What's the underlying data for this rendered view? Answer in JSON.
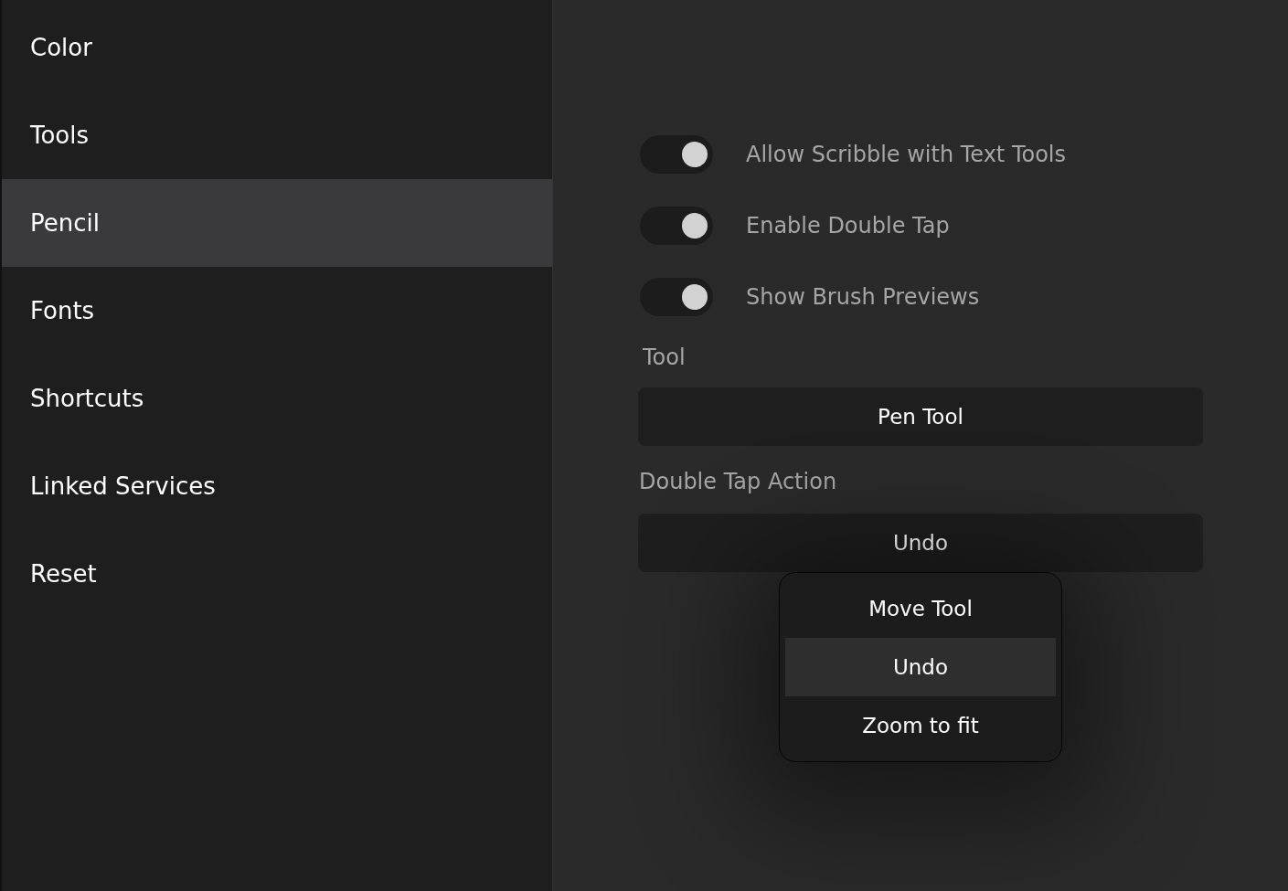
{
  "sidebar": {
    "items": [
      {
        "label": "Color",
        "selected": false
      },
      {
        "label": "Tools",
        "selected": false
      },
      {
        "label": "Pencil",
        "selected": true
      },
      {
        "label": "Fonts",
        "selected": false
      },
      {
        "label": "Shortcuts",
        "selected": false
      },
      {
        "label": "Linked Services",
        "selected": false
      },
      {
        "label": "Reset",
        "selected": false
      }
    ]
  },
  "toggles": [
    {
      "label": "Allow Scribble with Text Tools",
      "on": true
    },
    {
      "label": "Enable Double Tap",
      "on": true
    },
    {
      "label": "Show Brush Previews",
      "on": true
    }
  ],
  "tool": {
    "label": "Tool",
    "value": "Pen Tool"
  },
  "double_tap_action": {
    "label": "Double Tap Action",
    "value": "Undo",
    "menu": [
      {
        "label": "Move Tool",
        "selected": false
      },
      {
        "label": "Undo",
        "selected": true
      },
      {
        "label": "Zoom to fit",
        "selected": false
      }
    ]
  }
}
